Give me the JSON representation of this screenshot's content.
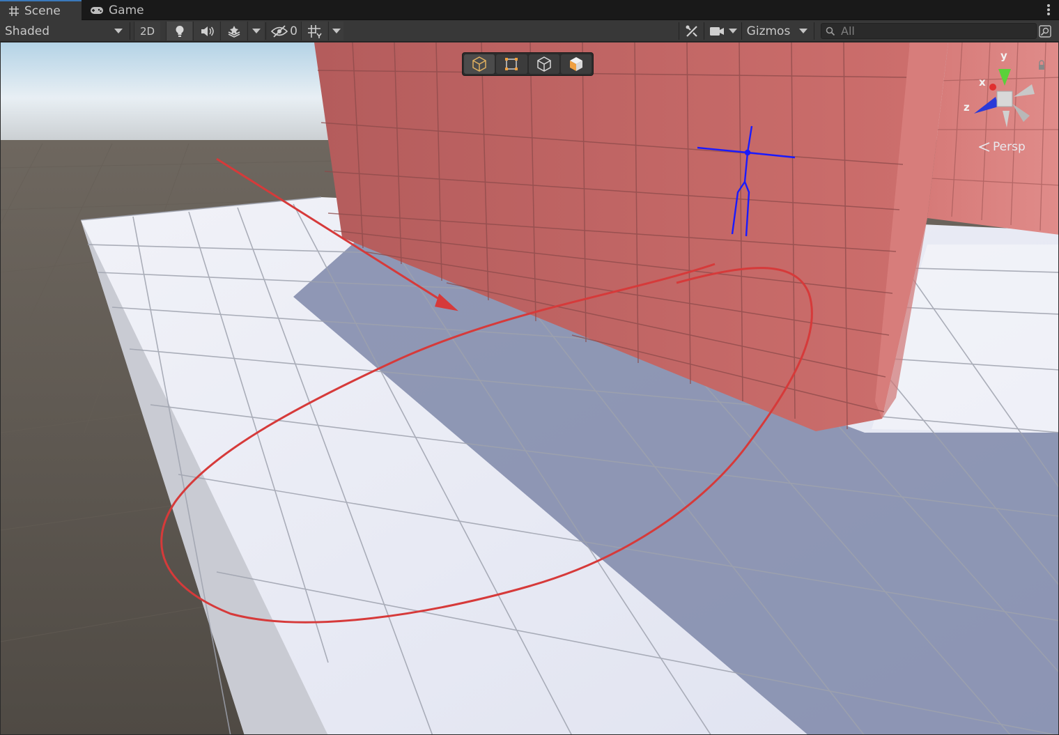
{
  "tabs": [
    {
      "label": "Scene",
      "icon": "scene-grid-icon",
      "active": true
    },
    {
      "label": "Game",
      "icon": "gamepad-icon",
      "active": false
    }
  ],
  "toolbar": {
    "draw_mode": "Shaded",
    "toggle_2d": "2D",
    "hidden_count": "0",
    "gizmos_label": "Gizmos",
    "search_placeholder": "All"
  },
  "scene_view": {
    "projection": "Persp",
    "axes": {
      "y": "y",
      "x": "x",
      "z": "z"
    }
  },
  "colors": {
    "accent_tab": "#3a79bb",
    "wall": "#c86a68",
    "floor": "#e6e9f5",
    "shadow": "#7d86a8",
    "annotation": "#d63a3a",
    "rig": "#1a1aff"
  }
}
